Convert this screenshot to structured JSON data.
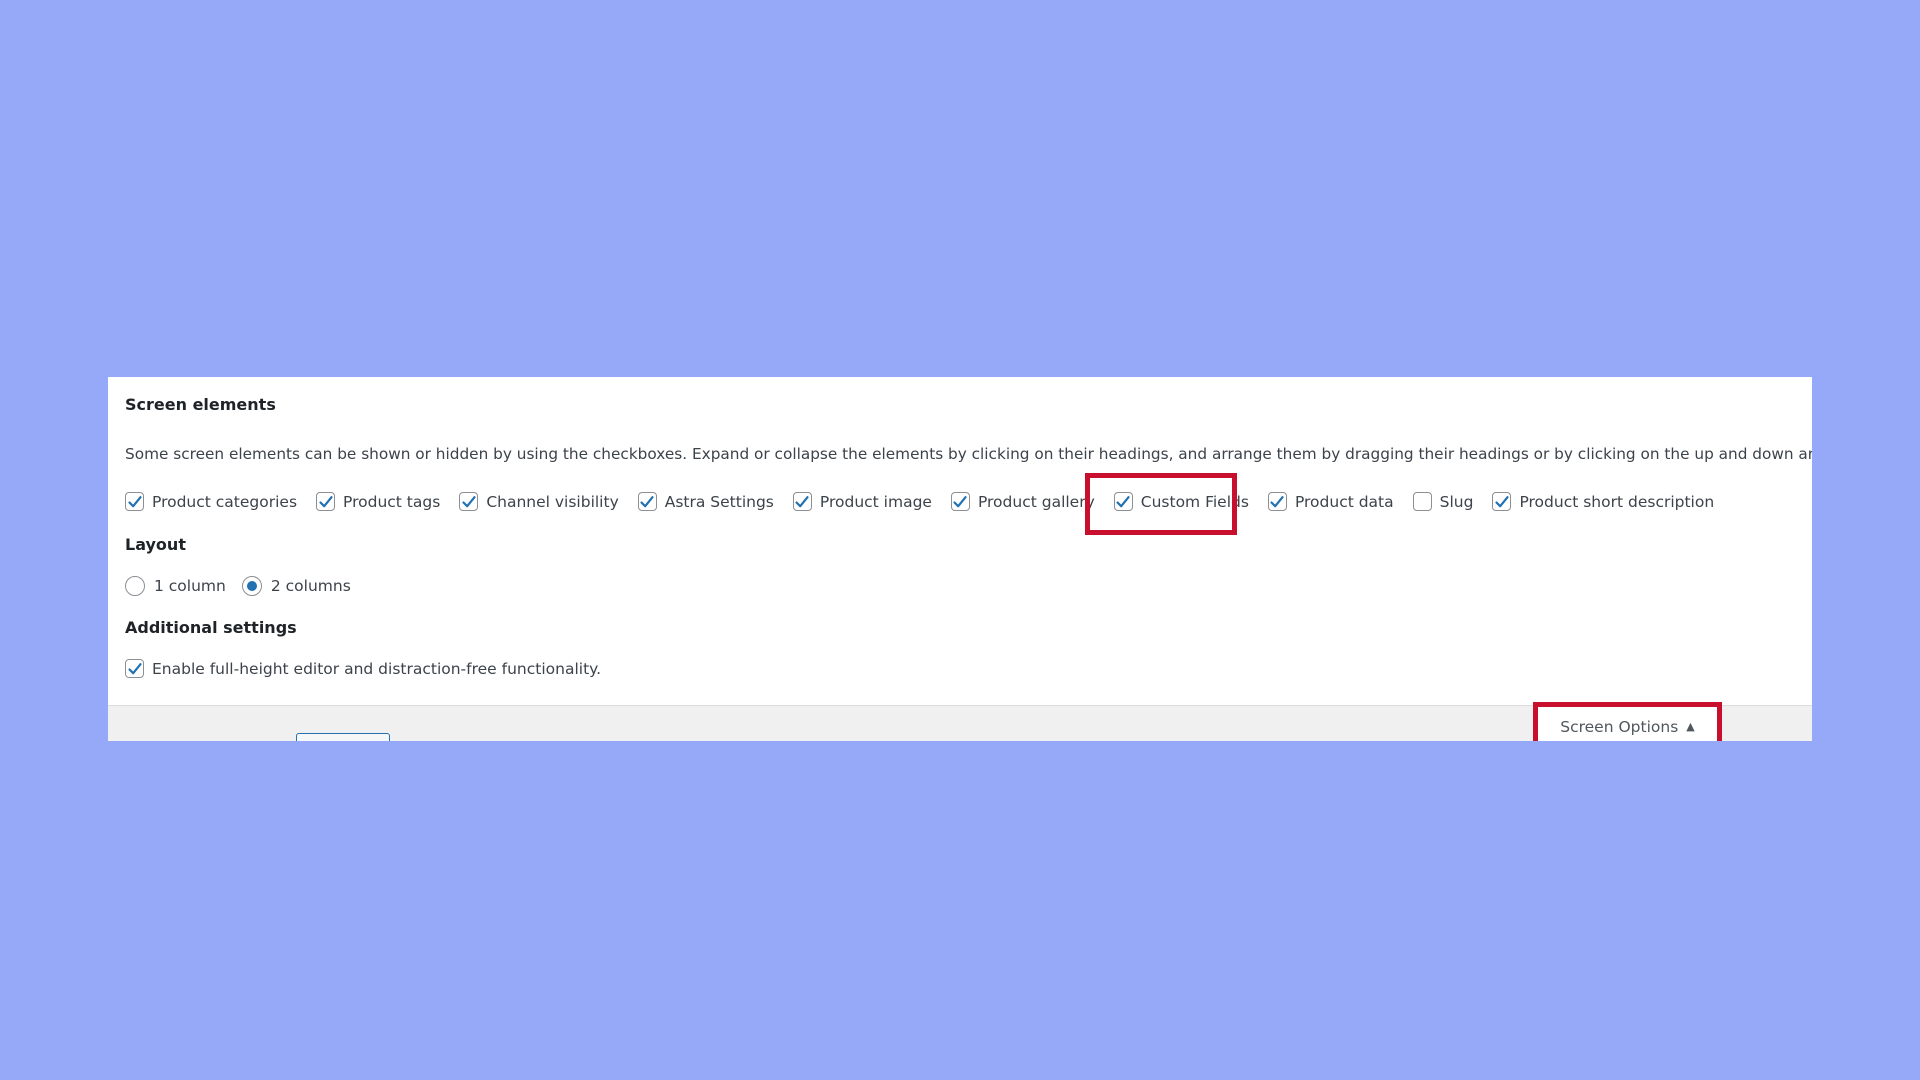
{
  "screen_elements": {
    "heading": "Screen elements",
    "description": "Some screen elements can be shown or hidden by using the checkboxes. Expand or collapse the elements by clicking on their headings, and arrange them by dragging their headings or by clicking on the up and down arrows.",
    "options": [
      {
        "label": "Product categories",
        "checked": true
      },
      {
        "label": "Product tags",
        "checked": true
      },
      {
        "label": "Channel visibility",
        "checked": true
      },
      {
        "label": "Astra Settings",
        "checked": true
      },
      {
        "label": "Product image",
        "checked": true
      },
      {
        "label": "Product gallery",
        "checked": true
      },
      {
        "label": "Custom Fields",
        "checked": true
      },
      {
        "label": "Product data",
        "checked": true
      },
      {
        "label": "Slug",
        "checked": false
      },
      {
        "label": "Product short description",
        "checked": true
      }
    ]
  },
  "layout": {
    "heading": "Layout",
    "options": [
      {
        "label": "1 column",
        "selected": false
      },
      {
        "label": "2 columns",
        "selected": true
      }
    ]
  },
  "additional_settings": {
    "heading": "Additional settings",
    "options": [
      {
        "label": "Enable full-height editor and distraction-free functionality.",
        "checked": true
      }
    ]
  },
  "screen_options_button": {
    "label": "Screen Options",
    "icon": "arrow-up-icon"
  },
  "colors": {
    "background": "#96a8f8",
    "accent": "#2271b1",
    "highlight": "#c8102e"
  }
}
